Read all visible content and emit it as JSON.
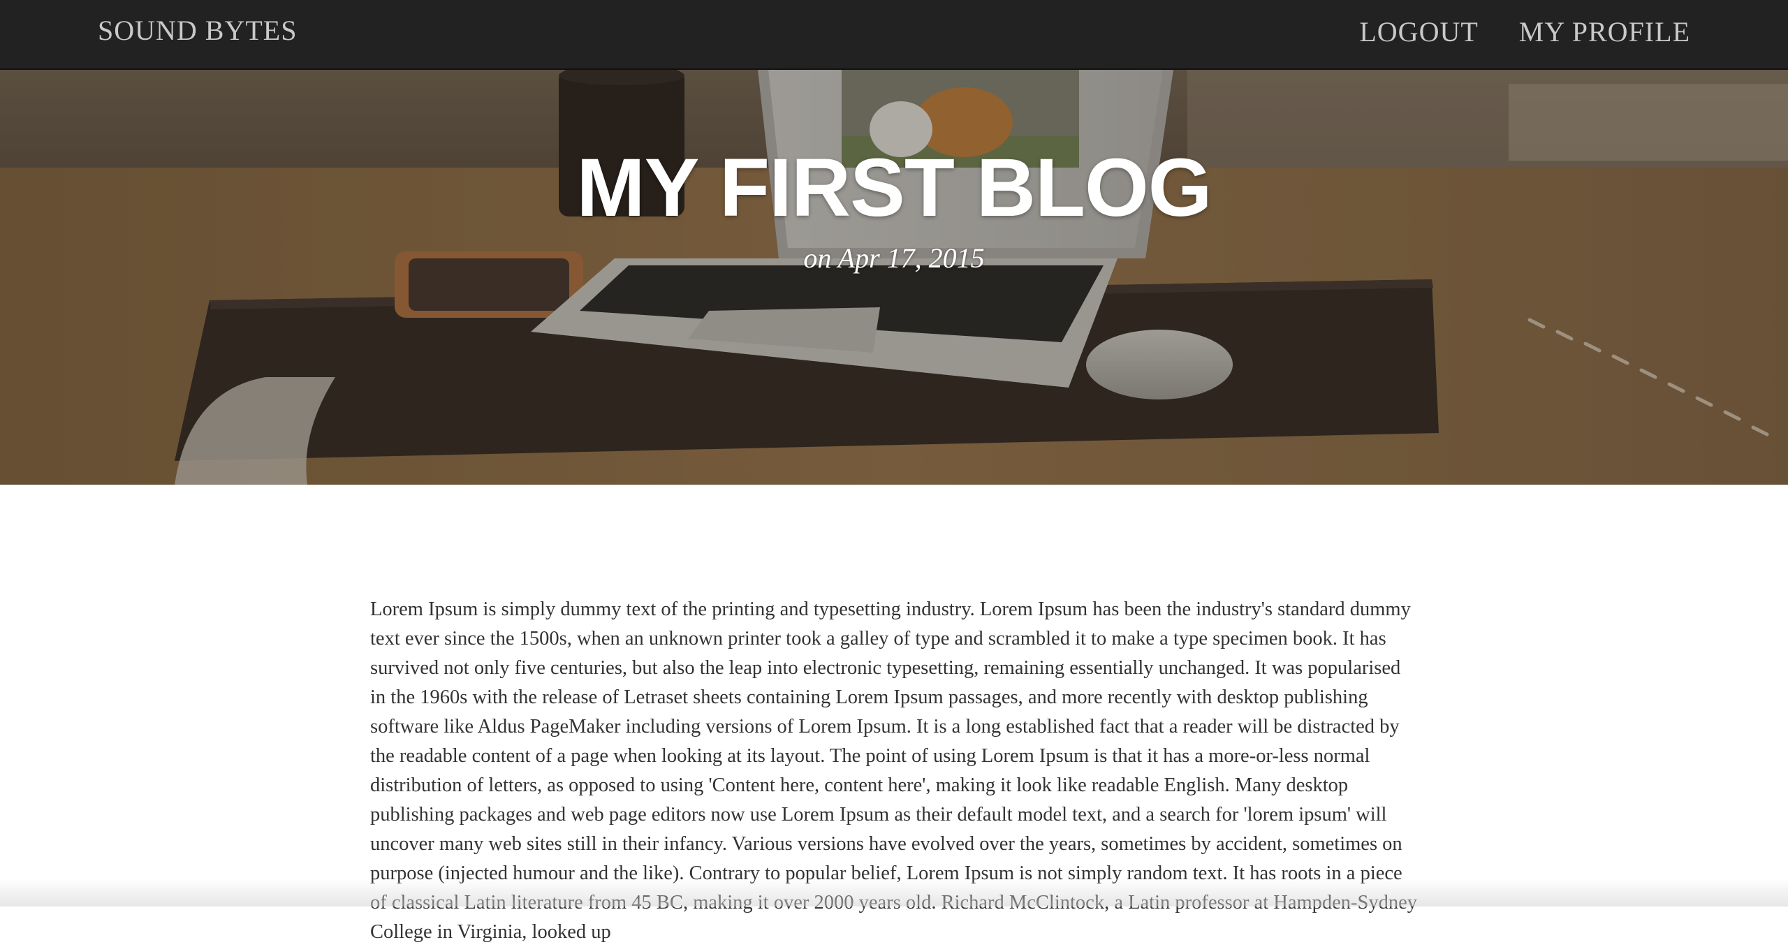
{
  "nav": {
    "brand": "SOUND BYTES",
    "links": [
      "LOGOUT",
      "MY PROFILE"
    ]
  },
  "hero": {
    "title": "MY FIRST BLOG",
    "date": "on Apr 17, 2015"
  },
  "post": {
    "body": "Lorem Ipsum is simply dummy text of the printing and typesetting industry. Lorem Ipsum has been the industry's standard dummy text ever since the 1500s, when an unknown printer took a galley of type and scrambled it to make a type specimen book. It has survived not only five centuries, but also the leap into electronic typesetting, remaining essentially unchanged. It was popularised in the 1960s with the release of Letraset sheets containing Lorem Ipsum passages, and more recently with desktop publishing software like Aldus PageMaker including versions of Lorem Ipsum. It is a long established fact that a reader will be distracted by the readable content of a page when looking at its layout. The point of using Lorem Ipsum is that it has a more-or-less normal distribution of letters, as opposed to using 'Content here, content here', making it look like readable English. Many desktop publishing packages and web page editors now use Lorem Ipsum as their default model text, and a search for 'lorem ipsum' will uncover many web sites still in their infancy. Various versions have evolved over the years, sometimes by accident, sometimes on purpose (injected humour and the like). Contrary to popular belief, Lorem Ipsum is not simply random text. It has roots in a piece of classical Latin literature from 45 BC, making it over 2000 years old. Richard McClintock, a Latin professor at Hampden-Sydney College in Virginia, looked up"
  },
  "colors": {
    "navbar_bg": "#222222",
    "nav_text": "#c9c9c9",
    "hero_text": "#ffffff",
    "body_text": "#333333"
  }
}
